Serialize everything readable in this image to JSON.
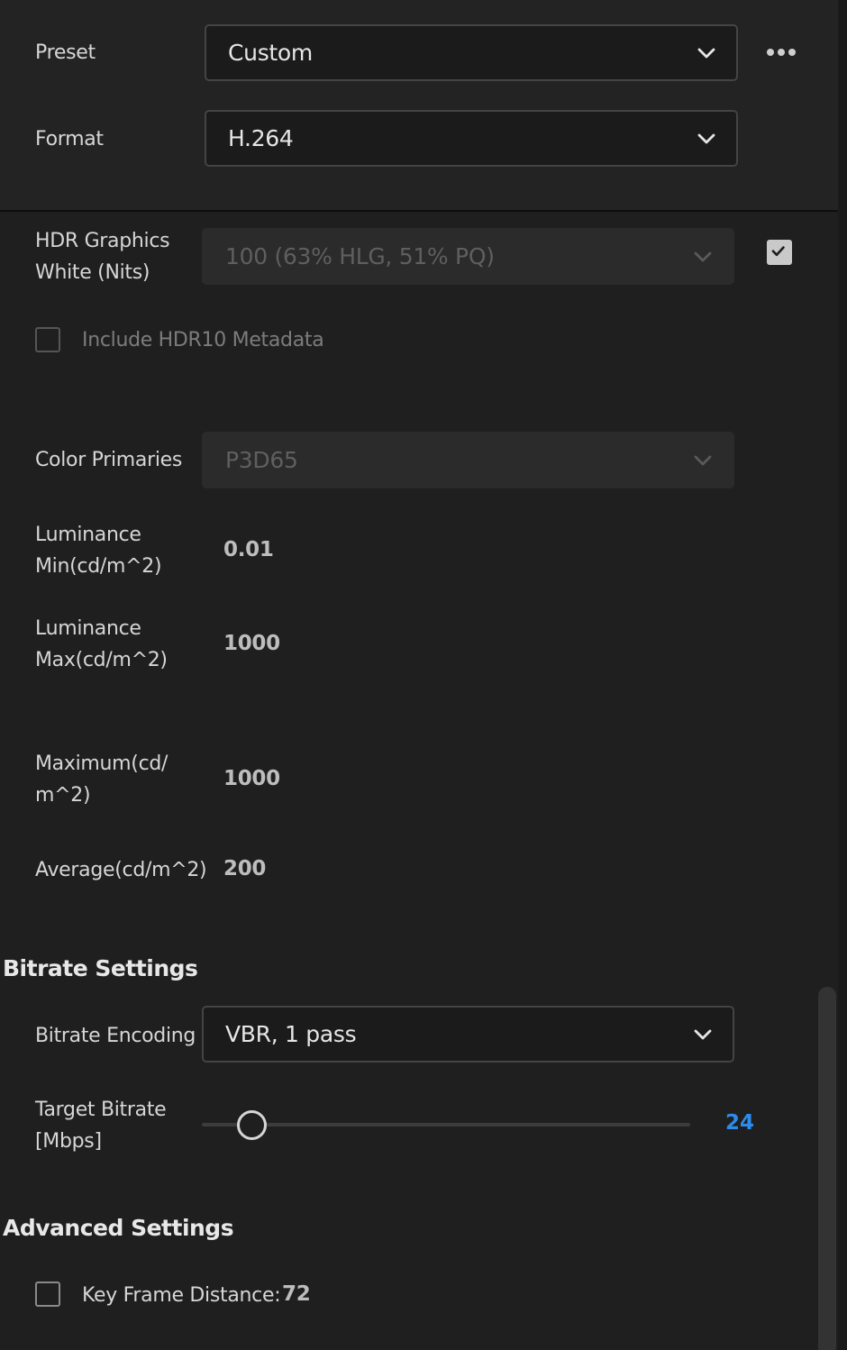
{
  "header": {
    "preset_label": "Preset",
    "preset_value": "Custom",
    "format_label": "Format",
    "format_value": "H.264"
  },
  "hdr": {
    "graphics_white_label_line1": "HDR Graphics",
    "graphics_white_label_line2": "White (Nits)",
    "graphics_white_value": "100 (63% HLG, 51% PQ)",
    "graphics_white_checked": true,
    "include_metadata_label": "Include HDR10 Metadata",
    "include_metadata_checked": false,
    "color_primaries_label": "Color Primaries",
    "color_primaries_value": "P3D65",
    "lum_min_label_line1": "Luminance",
    "lum_min_label_line2": "Min(cd/m^2)",
    "lum_min_value": "0.01",
    "lum_max_label_line1": "Luminance",
    "lum_max_label_line2": "Max(cd/m^2)",
    "lum_max_value": "1000",
    "maximum_label_line1": "Maximum(cd/",
    "maximum_label_line2": "m^2)",
    "maximum_value": "1000",
    "average_label": "Average(cd/m^2)",
    "average_value": "200"
  },
  "bitrate": {
    "section_title": "Bitrate Settings",
    "encoding_label": "Bitrate Encoding",
    "encoding_value": "VBR, 1 pass",
    "target_label_line1": "Target Bitrate",
    "target_label_line2": "[Mbps]",
    "target_value": "24"
  },
  "advanced": {
    "section_title": "Advanced Settings",
    "key_frame_label": "Key Frame Distance:",
    "key_frame_value": "72",
    "key_frame_checked": false
  },
  "icons": {
    "dropdown": "chevron-down-icon",
    "more": "more-horizontal-icon",
    "check": "checkmark-icon"
  },
  "colors": {
    "accent": "#2d8ceb",
    "background": "#1f1f1f"
  }
}
